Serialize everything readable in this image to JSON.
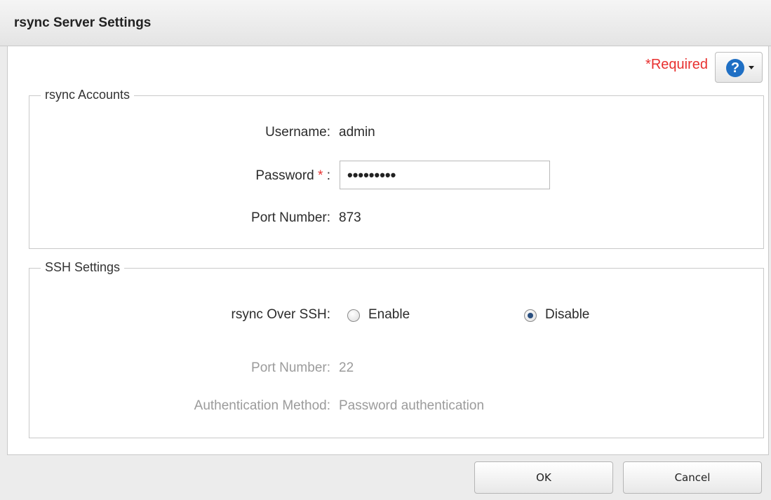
{
  "dialog": {
    "title": "rsync Server Settings"
  },
  "header": {
    "required_label": "*Required",
    "help_icon": "question-circle-icon",
    "help_glyph": "?"
  },
  "accounts": {
    "legend": "rsync Accounts",
    "username_label": "Username:",
    "username_value": "admin",
    "password_label": "Password",
    "password_star": "*",
    "password_colon": ":",
    "password_value": "•••••••••",
    "port_label": "Port Number:",
    "port_value": "873"
  },
  "ssh": {
    "legend": "SSH Settings",
    "over_ssh_label": "rsync Over SSH:",
    "enable_label": "Enable",
    "disable_label": "Disable",
    "selected": "Disable",
    "port_label": "Port Number:",
    "port_value": "22",
    "auth_label": "Authentication Method:",
    "auth_value": "Password authentication"
  },
  "footer": {
    "ok_label": "OK",
    "cancel_label": "Cancel"
  },
  "colors": {
    "required": "#e8302f",
    "help_blue": "#1f6fc4",
    "disabled_text": "#9b9b9b"
  }
}
